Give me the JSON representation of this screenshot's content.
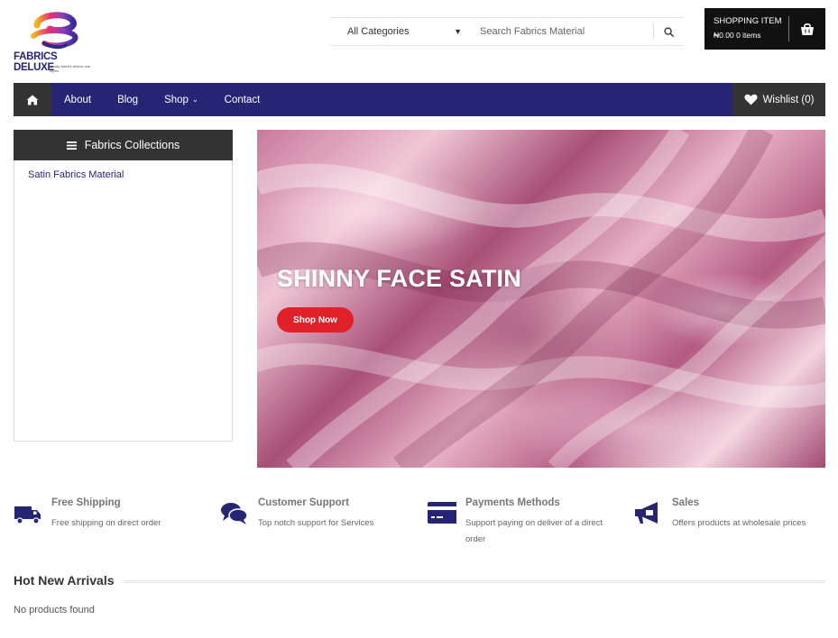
{
  "logo": {
    "text": "FABRICS DELUXE",
    "tagline": "quality fabrics deluxe and styles"
  },
  "search": {
    "category": "All Categories",
    "placeholder": "Search Fabrics Material"
  },
  "cart": {
    "title": "SHOPPING ITEM",
    "total": "₦0.00",
    "items": "0 items"
  },
  "nav": {
    "items": [
      {
        "label": "About"
      },
      {
        "label": "Blog"
      },
      {
        "label": "Shop"
      },
      {
        "label": "Contact"
      }
    ],
    "wishlist": "Wishlist (0)"
  },
  "sidebar": {
    "heading": "Fabrics Collections",
    "links": [
      {
        "label": "Satin Fabrics Material"
      }
    ]
  },
  "hero": {
    "title": "SHINNY FACE SATIN",
    "button": "Shop Now"
  },
  "features": [
    {
      "title": "Free Shipping",
      "desc": "Free shipping on direct order",
      "icon": "truck-icon"
    },
    {
      "title": "Customer Support",
      "desc": "Top notch support for Services",
      "icon": "chat-icon"
    },
    {
      "title": "Payments Methods",
      "desc": "Support paying on deliver of a direct order",
      "icon": "credit-card-icon"
    },
    {
      "title": "Sales",
      "desc": "Offers products at wholesale prices",
      "icon": "megaphone-icon"
    }
  ],
  "arrivals": {
    "title": "Hot New Arrivals",
    "empty": "No products found"
  },
  "colors": {
    "brand": "#262475",
    "dark": "#333333",
    "accent": "#e0212a"
  }
}
